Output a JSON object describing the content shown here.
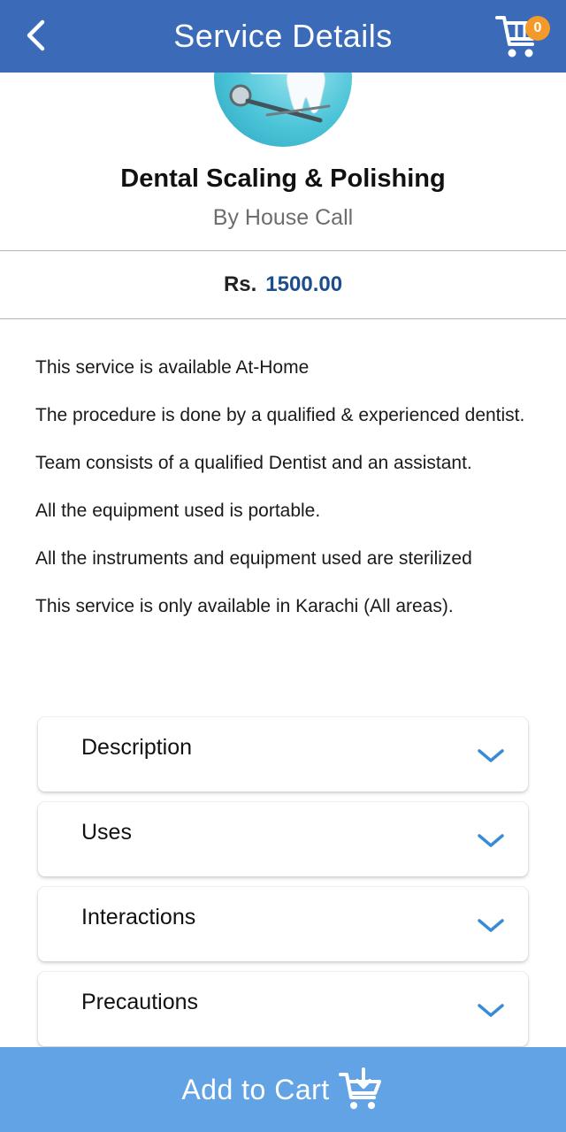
{
  "header": {
    "title": "Service Details",
    "cart_count": "0"
  },
  "service": {
    "name": "Dental Scaling & Polishing",
    "provider": "By House Call",
    "price_currency": "Rs.",
    "price_value": "1500.00"
  },
  "info_lines": [
    "This service is available At-Home",
    "The procedure is done by a qualified & experienced dentist.",
    "Team consists of a qualified Dentist and an assistant.",
    "All the equipment used is portable.",
    "All the instruments and equipment used are sterilized",
    "This service is only available in Karachi (All areas)."
  ],
  "accordion": [
    {
      "label": "Description"
    },
    {
      "label": "Uses"
    },
    {
      "label": "Interactions"
    },
    {
      "label": "Precautions"
    }
  ],
  "footer": {
    "add_to_cart_label": "Add to Cart"
  },
  "colors": {
    "header_bg": "#3b6bb8",
    "price_accent": "#1c4d8c",
    "chevron": "#3a8ad6",
    "cart_badge": "#f39a2b",
    "footer_bg": "#62a3e6"
  },
  "icons": {
    "back": "back-arrow-icon",
    "cart": "shopping-cart-icon",
    "chevron": "chevron-down-icon",
    "add_to_cart": "cart-add-icon"
  }
}
